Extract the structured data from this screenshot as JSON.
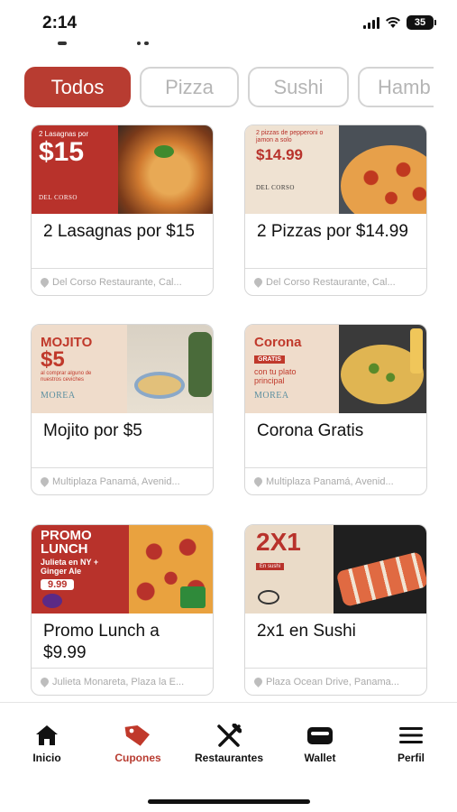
{
  "status_bar": {
    "time": "2:14",
    "battery": "35"
  },
  "categories": [
    {
      "label": "Todos",
      "active": true
    },
    {
      "label": "Pizza",
      "active": false
    },
    {
      "label": "Sushi",
      "active": false
    },
    {
      "label": "Hamb",
      "active": false
    }
  ],
  "coupons": [
    {
      "title": "2 Lasagnas por $15",
      "location": "Del Corso Restaurante, Cal...",
      "image": {
        "small_text": "2 Lasagnas por",
        "big_text": "$15",
        "brand": "DEL CORSO"
      }
    },
    {
      "title": "2 Pizzas por $14.99",
      "location": "Del Corso Restaurante, Cal...",
      "image": {
        "small_text": "2 pizzas de pepperoni o jamon a solo",
        "big_text": "$14.99",
        "brand": "DEL CORSO"
      }
    },
    {
      "title": "Mojito por $5",
      "location": "Multiplaza Panamá, Avenid...",
      "image": {
        "headline": "MOJITO",
        "big_text": "$5",
        "small_text": "al comprar alguno de nuestros ceviches",
        "brand": "MOREA"
      }
    },
    {
      "title": "Corona Gratis",
      "location": "Multiplaza Panamá, Avenid...",
      "image": {
        "headline": "Corona",
        "badge": "GRATIS",
        "small_text": "con tu plato principal",
        "brand": "MOREA"
      }
    },
    {
      "title": "Promo Lunch a $9.99",
      "location": "Julieta Monareta, Plaza la E...",
      "image": {
        "headline": "PROMO LUNCH",
        "small_text": "Julieta en NY + Ginger Ale",
        "price": "9.99"
      }
    },
    {
      "title": "2x1 en Sushi",
      "location": "Plaza Ocean Drive, Panama...",
      "image": {
        "big_text": "2X1",
        "badge": "En sushi"
      }
    }
  ],
  "nav": [
    {
      "label": "Inicio",
      "icon": "home-icon",
      "active": false
    },
    {
      "label": "Cupones",
      "icon": "coupon-tag-icon",
      "active": true
    },
    {
      "label": "Restaurantes",
      "icon": "fork-knife-icon",
      "active": false
    },
    {
      "label": "Wallet",
      "icon": "wallet-icon",
      "active": false
    },
    {
      "label": "Perfil",
      "icon": "menu-icon",
      "active": false
    }
  ],
  "colors": {
    "accent": "#b83c31",
    "border": "#d6d6d6",
    "muted_text": "#aaaaaa"
  }
}
